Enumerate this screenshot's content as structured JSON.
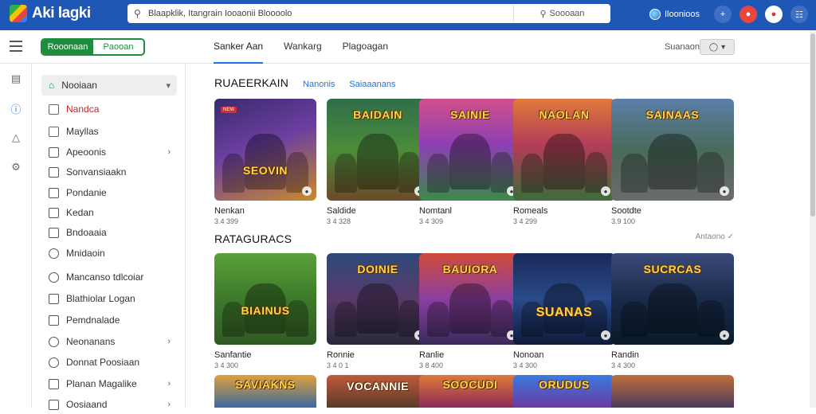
{
  "app": {
    "logo_text": "Aki lagki",
    "search_text": "Blaapklik, Itangrain Iooaonii Bloooolo",
    "search_button": "Soooaan",
    "region_label": "Iloonioos"
  },
  "subheader": {
    "toggle_on": "Rooonaan",
    "toggle_off": "Paooan",
    "tabs": [
      {
        "label": "Sanker Aan",
        "active": true
      },
      {
        "label": "Wankarg",
        "active": false
      },
      {
        "label": "Plagoagan",
        "active": false
      }
    ],
    "right_label": "Suanaon"
  },
  "sidebar": {
    "items": [
      {
        "label": "Nooiaan",
        "chevron": "down"
      },
      {
        "label": "Nandca",
        "active": true
      },
      {
        "label": "Mayllas"
      },
      {
        "label": "Apeoonis",
        "chevron": "right"
      },
      {
        "label": "Sonvansiaakn"
      },
      {
        "label": "Pondanie"
      },
      {
        "label": "Kedan"
      },
      {
        "label": "Bndoaaia"
      },
      {
        "label": "Mnidaoin"
      },
      {
        "label": "Mancanso tdlcoiar"
      },
      {
        "label": "Blathiolar Logan"
      },
      {
        "label": "Pemdnalade"
      },
      {
        "label": "Neonanans",
        "chevron": "right"
      },
      {
        "label": "Donnat Poosiaan"
      },
      {
        "label": "Planan Magalike",
        "chevron": "right"
      },
      {
        "label": "Oosiaand",
        "chevron": "right"
      }
    ]
  },
  "sections": [
    {
      "title": "RUAEERKAIN",
      "links": [
        "Nanonis",
        "Saiaaanans"
      ],
      "more": "",
      "cards": [
        {
          "title": "SEOVIN",
          "name": "Nenkan",
          "meta": "3.4 399",
          "tag": "NEW"
        },
        {
          "title": "BAIDAIN",
          "name": "Saldide",
          "meta": "3 4 328"
        },
        {
          "title": "SAINIE",
          "name": "Nomtanl",
          "meta": "3 4 309"
        },
        {
          "title": "NAOLAN",
          "name": "Romeals",
          "meta": "3 4 299"
        },
        {
          "title": "SAINAAS",
          "name": "Sootdte",
          "meta": "3.9 100"
        }
      ]
    },
    {
      "title": "RATAGURACS",
      "links": [],
      "more": "Antaono ✓",
      "cards": [
        {
          "title": "BIAINUS",
          "name": "Sanfantie",
          "meta": "3 4 300"
        },
        {
          "title": "DOINIE",
          "name": "Ronnie",
          "meta": "3 4 0 1"
        },
        {
          "title": "BAUIORA",
          "name": "Ranlie",
          "meta": "3 8 400"
        },
        {
          "title": "SUANAS",
          "name": "Nonoan",
          "meta": "3 4 300"
        },
        {
          "title": "SUCRCAS",
          "name": "Randin",
          "meta": "3 4 300"
        }
      ]
    },
    {
      "title": "",
      "links": [],
      "more": "",
      "cards": [
        {
          "title": "SAVIAKNS",
          "name": "",
          "meta": ""
        },
        {
          "title": "VOCANNIE",
          "name": "",
          "meta": ""
        },
        {
          "title": "SOOCUDI",
          "name": "",
          "meta": ""
        },
        {
          "title": "ORUDUS",
          "name": "",
          "meta": ""
        },
        {
          "title": "",
          "name": "",
          "meta": ""
        }
      ]
    }
  ],
  "colors": {
    "topbar": "#1f57b7",
    "toggle_green": "#1e8e3e",
    "link_blue": "#1a73e8",
    "active_red": "#c62828"
  }
}
